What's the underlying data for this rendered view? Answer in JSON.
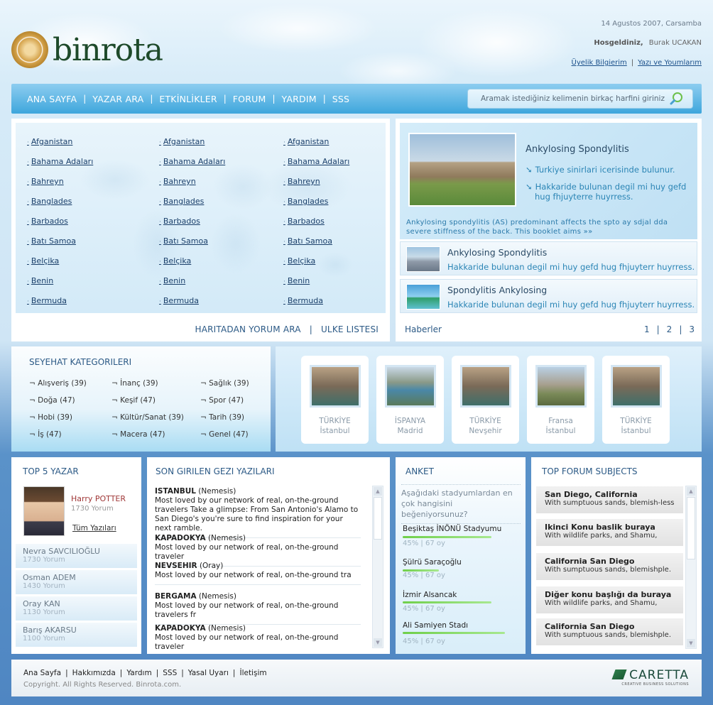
{
  "header": {
    "logo_text": "binrota",
    "date": "14 Agustos 2007, Carsamba",
    "welcome_label": "Hosgeldiniz,",
    "user_name": "Burak UCAKAN",
    "link_profile": "Üyelik Bilgierim",
    "link_posts": "Yazı ve Youmlarım"
  },
  "nav": {
    "items": [
      "ANA SAYFA",
      "YAZAR ARA",
      "ETKİNLİKLER",
      "FORUM",
      "YARDIM",
      "SSS"
    ],
    "search_placeholder": "Aramak istediğiniz kelimenin birkaç harfini giriniz"
  },
  "countries": {
    "columns": [
      [
        "Afganistan",
        "Bahama Adaları",
        "Bahreyn",
        "Banglades",
        "Barbados",
        "Batı Samoa",
        "Belçika",
        "Benin",
        "Bermuda"
      ],
      [
        "Afganistan",
        "Bahama Adaları",
        "Bahreyn",
        "Banglades",
        "Barbados",
        "Batı Samoa",
        "Belçika",
        "Benin",
        "Bermuda"
      ],
      [
        "Afganistan",
        "Bahama Adaları",
        "Bahreyn",
        "Banglades",
        "Barbados",
        "Batı Samoa",
        "Belçika",
        "Benin",
        "Bermuda"
      ]
    ],
    "footer_map": "HARITADAN YORUM ARA",
    "footer_list": "ULKE LISTESI"
  },
  "featured": {
    "title": "Ankylosing Spondylitis",
    "bullets": [
      "Turkiye sinirlari icerisinde bulunur.",
      "Hakkaride bulunan degil mi huy gefd",
      "hug fhjuyterre  huyrress."
    ],
    "description": "Ankylosing spondylitis (AS) predominant affects the spto ay sdjal dda severe stiffness of  the back. This booklet aims »»",
    "items": [
      {
        "title": "Ankylosing Spondylitis",
        "desc": "Hakkaride bulunan degil mi huy gefd  hug fhjuyterr huyrress."
      },
      {
        "title": "Spondylitis Ankylosing",
        "desc": "Hakkaride bulunan degil mi huy gefd  hug fhjuyterr huyrress."
      }
    ],
    "news_label": "Haberler",
    "pages": [
      "1",
      "|",
      "2",
      "|",
      "3"
    ]
  },
  "categories": {
    "title": "SEYEHAT KATEGORILERI",
    "items": [
      [
        "¬ Alışveriş  (39)",
        "¬ İnanç (39)",
        "¬ Sağlık (39)"
      ],
      [
        "¬ Doğa (47)",
        "¬ Keşif (47)",
        "¬ Spor (47)"
      ],
      [
        "¬ Hobi (39)",
        "¬ Kültür/Sanat (39)",
        "¬ Tarih (39)"
      ],
      [
        "¬ İş (47)",
        "¬ Macera (47)",
        "¬ Genel (47)"
      ]
    ]
  },
  "destinations": [
    {
      "country": "TÜRKİYE",
      "city": "İstanbul"
    },
    {
      "country": "İSPANYA",
      "city": "Madrid"
    },
    {
      "country": "TÜRKİYE",
      "city": "Nevşehir"
    },
    {
      "country": "Fransa",
      "city": "İstanbul"
    },
    {
      "country": "TÜRKİYE",
      "city": "İstanbul"
    }
  ],
  "top_authors": {
    "title": "TOP 5 YAZAR",
    "featured_name": "Harry POTTER",
    "featured_count": "1730 Yorum",
    "all_posts": "Tüm Yazıları",
    "list": [
      {
        "name": "Nevra SAVCILIOĞLU",
        "count": "1730 Yorum"
      },
      {
        "name": "Osman ADEM",
        "count": "1430 Yorum"
      },
      {
        "name": "Oray KAN",
        "count": "1130 Yorum"
      },
      {
        "name": "Barış AKARSU",
        "count": "1100 Yorum"
      }
    ]
  },
  "trips": {
    "title": "SON GIRILEN GEZI YAZILARI",
    "items": [
      {
        "place": "ISTANBUL",
        "author": " (Nemesis)",
        "text": "Most loved by our network of real, on-the-ground travelers Take a glimpse: From San Antonio's Alamo to San Diego's you're sure to find inspiration for your next ramble."
      },
      {
        "place": "KAPADOKYA",
        "author": " (Nemesis)",
        "text": "Most loved by our network of real, on-the-ground traveler"
      },
      {
        "place": "NEVSEHIR",
        "author": " (Oray)",
        "text": "Most loved by our network of real, on-the-ground tra"
      },
      {
        "place": "BERGAMA",
        "author": " (Nemesis)",
        "text": "Most loved by our network of real, on-the-ground travelers fr"
      },
      {
        "place": "KAPADOKYA",
        "author": " (Nemesis)",
        "text": "Most loved by our network of real, on-the-ground traveler"
      }
    ]
  },
  "poll": {
    "title": "ANKET",
    "question": "Aşağıdaki stadyumlardan en çok hangisini beğeniyorsunuz?",
    "options": [
      {
        "label": "Beşiktaş İNÖNÜ Stadyumu",
        "stats": "45% | 67 oy",
        "fill": 0.78
      },
      {
        "label": "Şülrü Saraçoğlu",
        "stats": "45% | 67 oy",
        "fill": 0.32
      },
      {
        "label": "İzmir Alsancak",
        "stats": "45% | 67 oy",
        "fill": 0.78
      },
      {
        "label": "Ali Samiyen Stadı",
        "stats": "45% | 67 oy",
        "fill": 0.9
      }
    ]
  },
  "forum": {
    "title": "TOP FORUM SUBJECTS",
    "items": [
      {
        "title": "San Diego, California",
        "desc": "With sumptuous sands, blemish-less"
      },
      {
        "title": "Ikinci Konu baslik buraya",
        "desc": "With wildlife parks, and Shamu,"
      },
      {
        "title": "California San Diego",
        "desc": "With sumptuous sands, blemishple."
      },
      {
        "title": "Diğer konu başlığı da buraya",
        "desc": "With wildlife parks, and Shamu,"
      },
      {
        "title": "California San Diego",
        "desc": "With sumptuous sands, blemishple."
      }
    ]
  },
  "footer": {
    "links": [
      "Ana Sayfa",
      "Hakkımızda",
      "Yardım",
      "SSS",
      "Yasal Uyarı",
      "İletişim"
    ],
    "copyright": "Copyright. All Rights Reserved. Binrota.com.",
    "brand": "CARETTA",
    "brand_tagline": "CREATIVE BUSINESS SOLUTIONS"
  }
}
